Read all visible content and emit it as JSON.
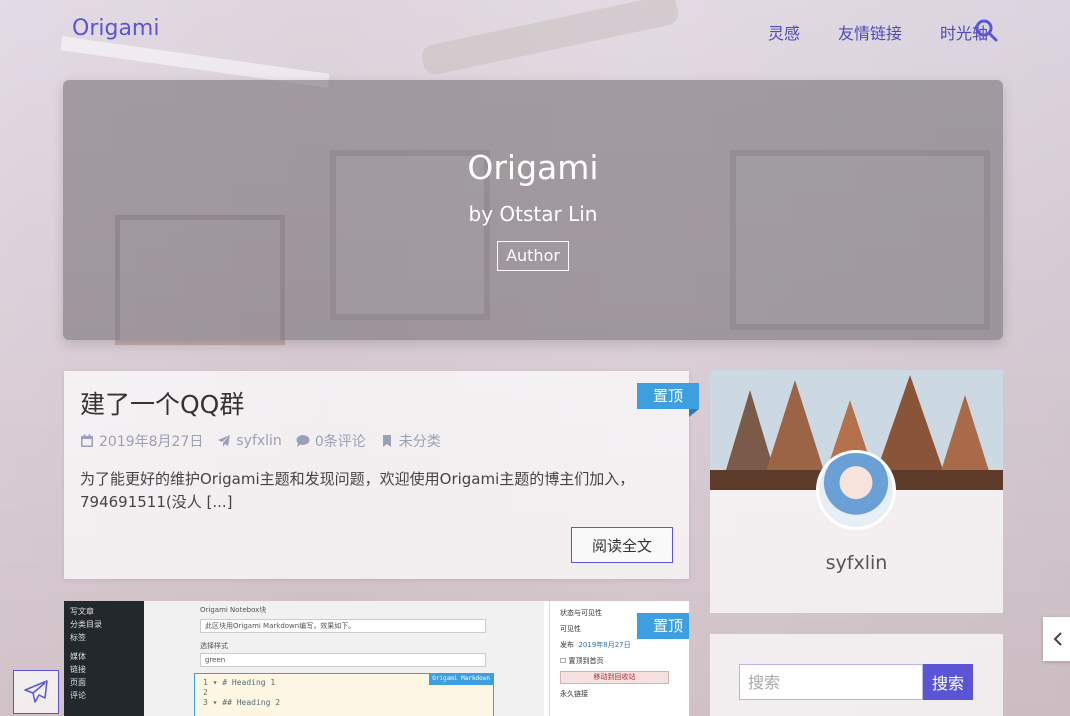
{
  "header": {
    "brand": "Origami",
    "nav": [
      {
        "label": "灵感"
      },
      {
        "label": "友情链接"
      },
      {
        "label": "时光轴"
      }
    ]
  },
  "banner": {
    "title": "Origami",
    "subtitle": "by Otstar Lin",
    "badge": "Author"
  },
  "posts": [
    {
      "title": "建了一个QQ群",
      "sticky": "置顶",
      "date": "2019年8月27日",
      "author": "syfxlin",
      "comments": "0条评论",
      "category": "未分类",
      "excerpt": "为了能更好的维护Origami主题和发现问题，欢迎使用Origami主题的博主们加入，794691511(没人 [...]",
      "read_more": "阅读全文"
    },
    {
      "sticky": "置顶",
      "screenshot": {
        "sidebar_items": [
          "写文章",
          "分类目录",
          "标签",
          "媒体",
          "链接",
          "页面",
          "评论"
        ],
        "label1": "Origami Notebox块",
        "input1": "此区块用Origami Markdown编写，效果如下。",
        "label2": "选择样式",
        "select": "green",
        "editor_mode": "Origami Markdown",
        "editor_lines": [
          "1 ▾ # Heading 1",
          "2",
          "3 ▾ ## Heading 2"
        ],
        "panel_title": "状态与可见性",
        "panel_visibility": "可见性",
        "panel_publish": "发布",
        "panel_publish_value": "2019年8月27日",
        "panel_sticky": "置顶到首页",
        "panel_trash": "移动到回收站",
        "panel_permalink": "永久链接"
      }
    }
  ],
  "sidebar": {
    "author_name": "syfxlin",
    "search_placeholder": "搜索",
    "search_button": "搜索"
  },
  "colors": {
    "accent": "#5b55d6",
    "sticky": "#3e9fe0"
  }
}
